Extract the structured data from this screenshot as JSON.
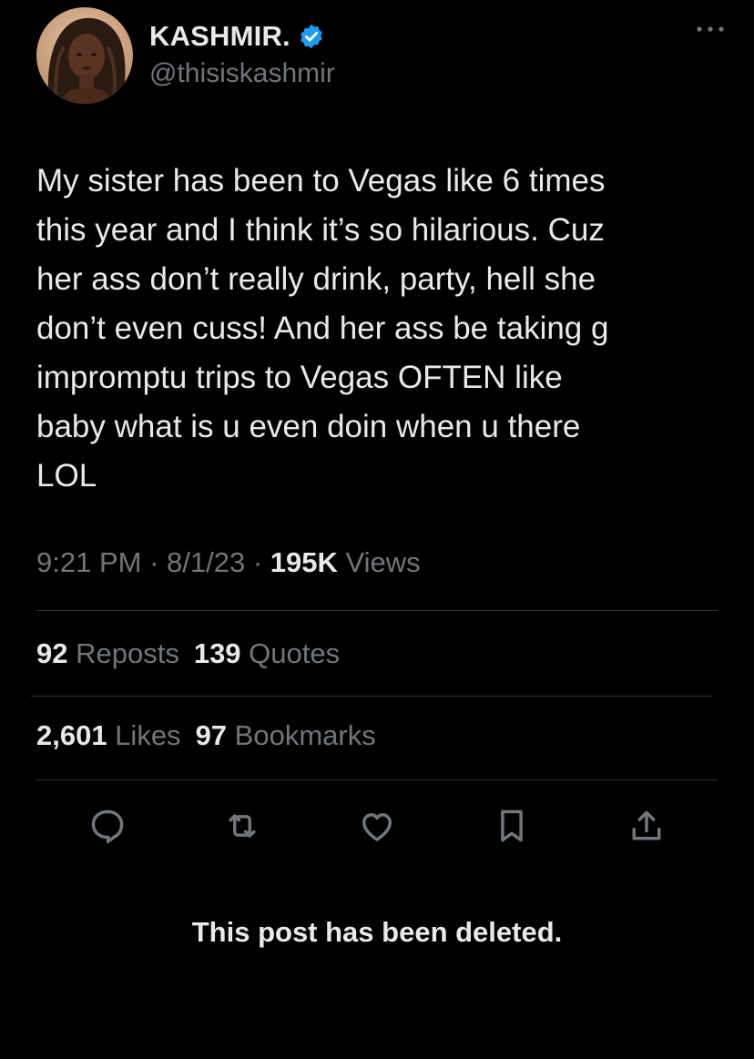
{
  "author": {
    "display_name": "KASHMIR.",
    "handle": "@thisiskashmir",
    "verified": true,
    "verified_color": "#1d9bf0",
    "avatar_icon": "user-avatar-photo"
  },
  "header": {
    "more_icon": "more-dots-icon"
  },
  "tweet": {
    "text": "My sister has been to Vegas like 6 times\nthis year and I think it’s so hilarious. Cuz\nher ass don’t really drink, party, hell she\ndon’t even cuss! And her ass be taking g\nimpromptu trips to Vegas OFTEN like\nbaby what is u even doin when u there\nLOL"
  },
  "meta": {
    "time": "9:21 PM",
    "separator": " · ",
    "date": "8/1/23",
    "views_count": "195K",
    "views_label": " Views"
  },
  "stats": {
    "reposts_count": "92",
    "reposts_label": " Reposts",
    "quotes_count": "139",
    "quotes_label": " Quotes",
    "likes_count": "2,601",
    "likes_label": " Likes",
    "bookmarks_count": "97",
    "bookmarks_label": " Bookmarks"
  },
  "actions": [
    {
      "name": "reply",
      "icon": "reply-icon"
    },
    {
      "name": "repost",
      "icon": "repost-icon"
    },
    {
      "name": "like",
      "icon": "heart-icon"
    },
    {
      "name": "bookmark",
      "icon": "bookmark-icon"
    },
    {
      "name": "share",
      "icon": "share-icon"
    }
  ],
  "notice": {
    "deleted_text": "This post has been deleted."
  },
  "colors": {
    "background": "#000000",
    "primary_text": "#e7e9ea",
    "secondary_text": "#71767b",
    "divider": "#2f3336",
    "icon": "#71767b"
  }
}
